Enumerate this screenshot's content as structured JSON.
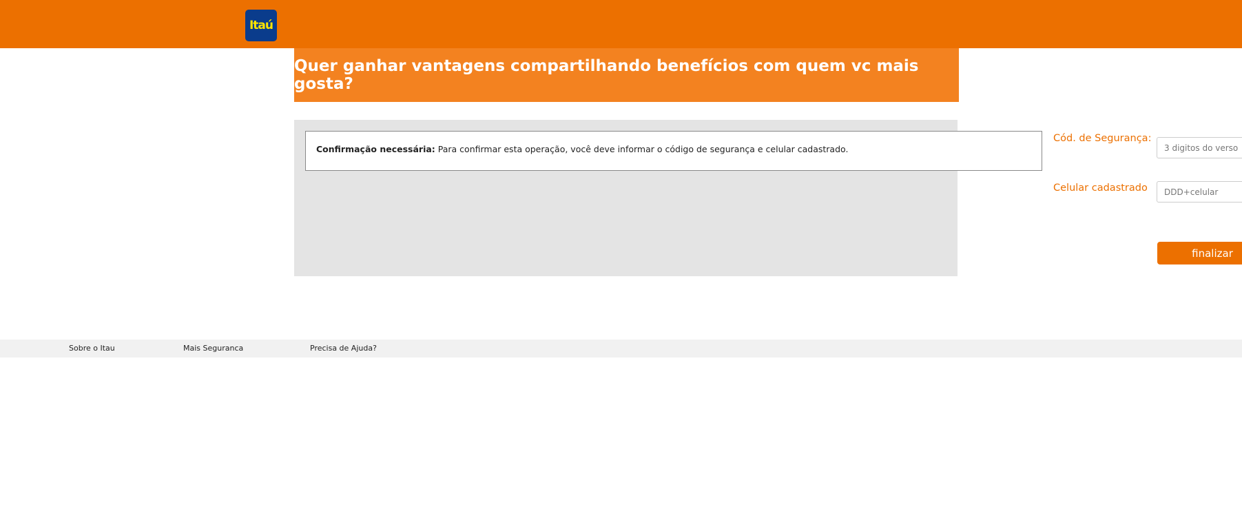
{
  "header": {
    "logo_text": "Itaú",
    "brand_color": "#ec7000"
  },
  "banner": {
    "title": "Quer ganhar vantagens compartilhando benefícios com quem vc mais gosta?"
  },
  "message": {
    "bold": "Confirmação necessária:",
    "text": " Para confirmar esta operação, você deve informar o código de segurança e celular cadastrado."
  },
  "form": {
    "security_label": "Cód. de Segurança:",
    "security_placeholder": "3 digitos do verso",
    "phone_label": "Celular cadastrado",
    "phone_placeholder": "DDD+celular",
    "submit_label": "finalizar"
  },
  "footer": {
    "links": [
      "Sobre o Itau",
      "Mais Seguranca",
      "Precisa de Ajuda?"
    ]
  }
}
